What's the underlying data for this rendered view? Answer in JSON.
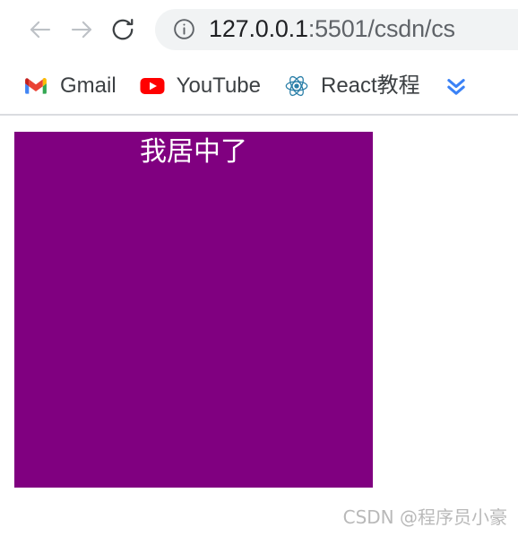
{
  "browser": {
    "nav": {
      "back_label": "Back",
      "forward_label": "Forward",
      "reload_label": "Reload"
    },
    "omnibox": {
      "site_info_label": "View site information",
      "url_host": "127.0.0.1",
      "url_path": ":5501/csdn/cs",
      "full_url": "127.0.0.1:5501/csdn/cs"
    },
    "bookmarks": [
      {
        "label": "Gmail",
        "icon": "gmail-icon"
      },
      {
        "label": "YouTube",
        "icon": "youtube-icon"
      },
      {
        "label": "React教程",
        "icon": "react-icon"
      },
      {
        "label": "",
        "icon": "double-chevron-down-icon"
      }
    ]
  },
  "page": {
    "box": {
      "text": "我居中了",
      "background_color": "#800080",
      "text_color": "#ffffff"
    },
    "watermark": "CSDN @程序员小豪"
  }
}
